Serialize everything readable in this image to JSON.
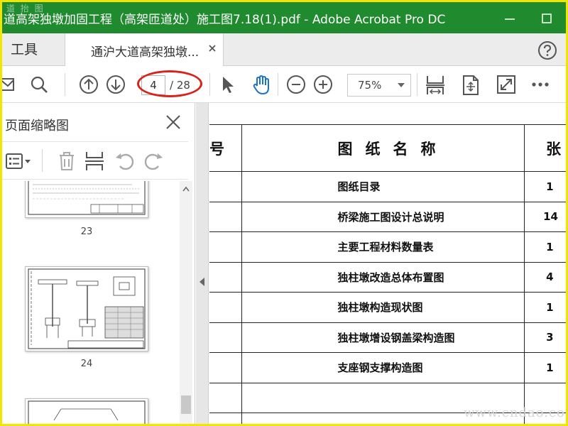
{
  "window": {
    "title": "道高架独墩加固工程（高架匝道处）施工图7.18(1).pdf - Adobe Acrobat Pro DC",
    "watermark": "道 抬 图"
  },
  "tabs": {
    "tools_label": "工具",
    "doc_label": "通沪大道高架独墩..."
  },
  "toolbar": {
    "current_page": "4",
    "total_pages": "/ 28",
    "zoom": "75%"
  },
  "sidebar": {
    "title": "页面缩略图",
    "thumbnails": [
      {
        "number": "23"
      },
      {
        "number": "24"
      }
    ]
  },
  "document": {
    "headers": {
      "no": "号",
      "name": "图纸名称",
      "count": "张 数"
    },
    "rows": [
      {
        "name": "图纸目录",
        "count": "1"
      },
      {
        "name": "桥梁施工图设计总说明",
        "count": "14"
      },
      {
        "name": "主要工程材料数量表",
        "count": "1"
      },
      {
        "name": "独柱墩改造总体布置图",
        "count": "4"
      },
      {
        "name": "独柱墩构造现状图",
        "count": "1"
      },
      {
        "name": "独柱墩增设钢盖梁构造图",
        "count": "3"
      },
      {
        "name": "支座钢支撑构造图",
        "count": "1"
      },
      {
        "name": "",
        "count": ""
      },
      {
        "name": "",
        "count": ""
      }
    ],
    "watermark": "www.cndao.com"
  },
  "colors": {
    "titlebar": "#1f8a2e",
    "frame": "#f2e600",
    "annotation": "#d8231c",
    "hand_tool": "#1a73c9"
  }
}
